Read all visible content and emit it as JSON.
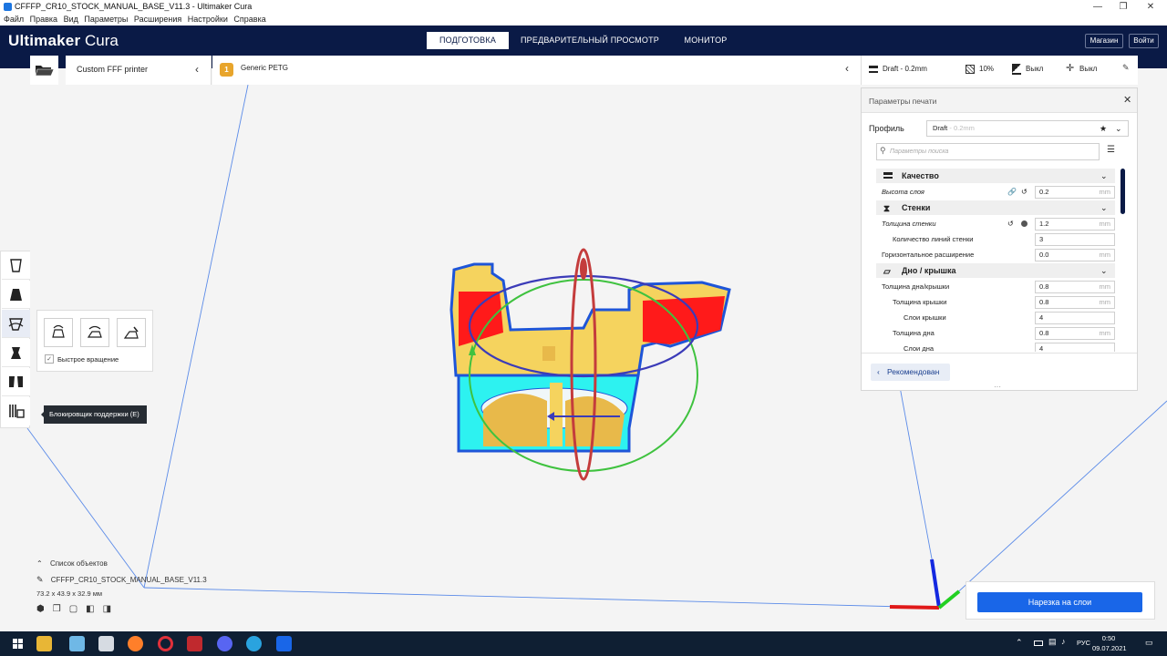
{
  "window": {
    "title": "CFFFP_CR10_STOCK_MANUAL_BASE_V11.3 - Ultimaker Cura",
    "minimize": "—",
    "maximize": "❐",
    "close": "✕"
  },
  "menu": [
    "Файл",
    "Правка",
    "Вид",
    "Параметры",
    "Расширения",
    "Настройки",
    "Справка"
  ],
  "header": {
    "logo_bold": "Ultimaker",
    "logo_light": "Cura",
    "tabs": [
      "ПОДГОТОВКА",
      "ПРЕДВАРИТЕЛЬНЫЙ ПРОСМОТР",
      "МОНИТОР"
    ],
    "store_button": "Магазин",
    "login_button": "Войти"
  },
  "toolbar": {
    "printer": "Custom FFF printer",
    "material_index": "1",
    "material": "Generic PETG",
    "profile": "Draft - 0.2mm",
    "infill": "10%",
    "support": "Выкл",
    "adhesion": "Выкл"
  },
  "panel": {
    "title": "Параметры печати",
    "profile_label": "Профиль",
    "profile_value": "Draft",
    "profile_hint": "- 0.2mm",
    "search_placeholder": "Параметры поиска",
    "recommended_button": "Рекомендован",
    "categories": {
      "quality": "Качество",
      "walls": "Стенки",
      "topbottom": "Дно / крышка"
    },
    "settings": [
      {
        "label": "Высота слоя",
        "value": "0.2",
        "unit": "mm"
      },
      {
        "label": "Толщина стенки",
        "value": "1.2",
        "unit": "mm"
      },
      {
        "label": "Количество линий стенки",
        "value": "3",
        "unit": ""
      },
      {
        "label": "Горизонтальное расширение",
        "value": "0.0",
        "unit": "mm"
      },
      {
        "label": "Толщина дна/крышки",
        "value": "0.8",
        "unit": "mm"
      },
      {
        "label": "Толщина крышки",
        "value": "0.8",
        "unit": "mm"
      },
      {
        "label": "Слои крышки",
        "value": "4",
        "unit": ""
      },
      {
        "label": "Толщина дна",
        "value": "0.8",
        "unit": "mm"
      },
      {
        "label": "Слои дна",
        "value": "4",
        "unit": ""
      }
    ]
  },
  "rotate_panel": {
    "snap_label": "Быстрое вращение"
  },
  "tooltip": "Блокировщик поддержки (E)",
  "object_list": {
    "header": "Список объектов",
    "name": "CFFFP_CR10_STOCK_MANUAL_BASE_V11.3",
    "dimensions": "73.2 x 43.9 x 32.9 мм"
  },
  "slice_button": "Нарезка на слои",
  "taskbar": {
    "language": "РУС",
    "time": "0:50",
    "date": "09.07.2021"
  },
  "colors": {
    "header_bg": "#0a1a46",
    "accent_blue": "#1966e8",
    "model_yellow": "#f5d35e",
    "overhang_red": "#ff1a1a",
    "model_cyan": "#2df2f0"
  }
}
